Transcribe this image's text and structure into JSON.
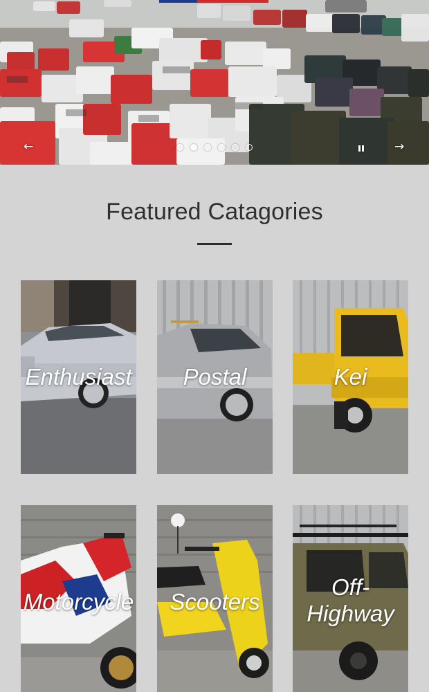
{
  "hero": {
    "prev_icon": "←",
    "next_icon": "→",
    "slide_count": 6,
    "active_slide": 2
  },
  "featured": {
    "title": "Featured Catagories"
  },
  "categories": [
    {
      "label": "Enthusiast"
    },
    {
      "label": "Postal"
    },
    {
      "label": "Kei"
    },
    {
      "label": "Motorcycle"
    },
    {
      "label": "Scooters"
    },
    {
      "label": "Off-\nHighway"
    }
  ],
  "colors": {
    "page_bg": "#d4d4d4",
    "heading": "#2f2f2f",
    "label": "#ffffff"
  }
}
